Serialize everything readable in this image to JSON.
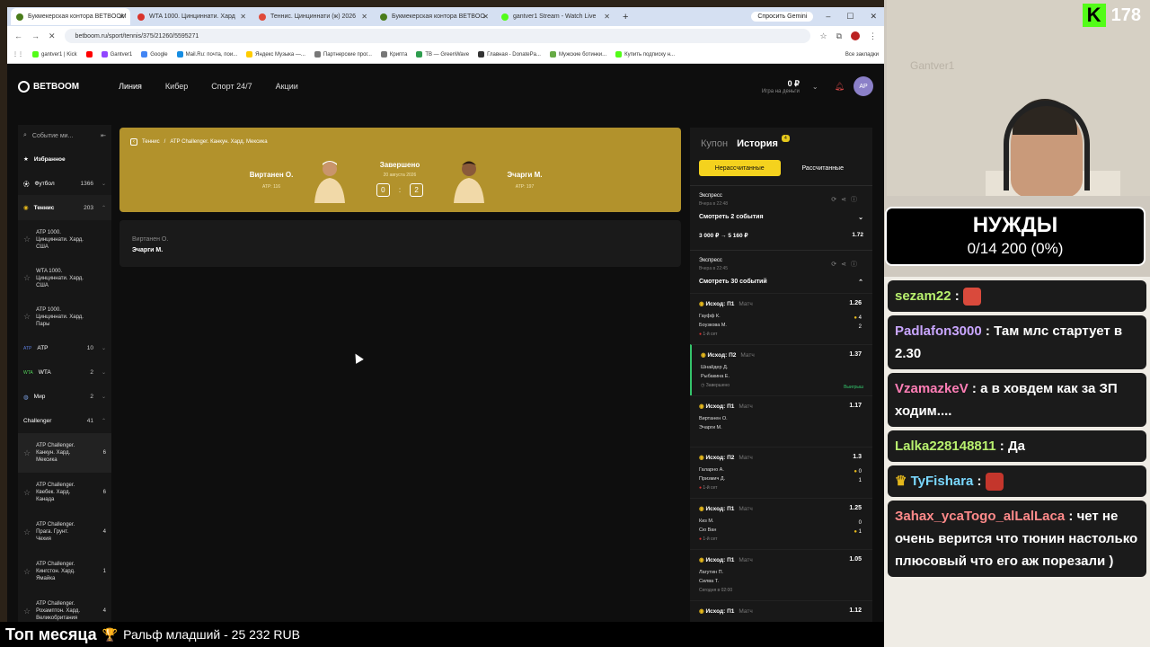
{
  "browser": {
    "tabs": [
      {
        "label": "Букмекерская контора BETBOOM",
        "color": "#4a7c1a",
        "active": true
      },
      {
        "label": "WTA 1000. Цинциннати. Хард",
        "color": "#d9332b"
      },
      {
        "label": "Теннис. Цинциннати (ж) 2026",
        "color": "#e04a3a"
      },
      {
        "label": "Букмекерская контора BETBOO",
        "color": "#4a7c1a"
      },
      {
        "label": "gantver1 Stream - Watch Live",
        "color": "#53fc18"
      }
    ],
    "gemini_label": "Спросить Gemini",
    "url": "betboom.ru/sport/tennis/375/21260/5595271",
    "bookmarks": [
      {
        "label": "gantver1 | Kick",
        "color": "#53fc18"
      },
      {
        "label": "",
        "color": "#ff0000"
      },
      {
        "label": "Gantver1",
        "color": "#9146ff"
      },
      {
        "label": "Google",
        "color": "#4285f4"
      },
      {
        "label": "Mail.Ru: почта, пои...",
        "color": "#168de2"
      },
      {
        "label": "Яндекс Музыка —...",
        "color": "#ffcc00"
      },
      {
        "label": "Партнерские прог...",
        "color": "#777777"
      },
      {
        "label": "Крипта",
        "color": "#777777"
      },
      {
        "label": "TB — GreenWave",
        "color": "#2e9d4e"
      },
      {
        "label": "Главная - DonatePa...",
        "color": "#333333"
      },
      {
        "label": "Мужские ботинки...",
        "color": "#6a4"
      },
      {
        "label": "Купить подписку н...",
        "color": "#53fc18"
      }
    ],
    "all_bookmarks": "Все закладки"
  },
  "site": {
    "logo": "BETBOOM",
    "nav": [
      "Линия",
      "Кибер",
      "Спорт 24/7",
      "Акции"
    ],
    "balance_amount": "0 ₽",
    "balance_label": "Игра на деньги",
    "avatar": "АР",
    "search_placeholder": "Событие ми...",
    "sidebar": {
      "favorites": "Избранное",
      "football": {
        "label": "Футбол",
        "count": "1366"
      },
      "tennis": {
        "label": "Теннис",
        "count": "203"
      },
      "tennis_subs": [
        {
          "label": "ATP 1000. Цинциннати. Хард. США"
        },
        {
          "label": "WTA 1000. Цинциннати. Хард. США"
        },
        {
          "label": "ATP 1000. Цинциннати. Хард. Пары"
        }
      ],
      "groups": [
        {
          "label": "ATP",
          "count": "10"
        },
        {
          "label": "WTA",
          "count": "2"
        },
        {
          "label": "Мир",
          "count": "2"
        },
        {
          "label": "Challenger",
          "count": "41"
        }
      ],
      "challenger_subs": [
        {
          "label": "ATP Challenger. Канкун. Хард. Мексика",
          "count": "6"
        },
        {
          "label": "ATP Challenger. Квебек. Хард. Канада",
          "count": "6"
        },
        {
          "label": "ATP Challenger. Прага. Грунт. Чехия",
          "count": "4"
        },
        {
          "label": "ATP Challenger. Кингстон. Хард. Ямайка",
          "count": "1"
        },
        {
          "label": "ATP Challenger. Рохамптон. Хард. Великобритания",
          "count": "4"
        }
      ]
    },
    "match": {
      "crumb_sport": "Теннис",
      "crumb_sep": "/",
      "crumb_tournament": "ATP Challenger. Канкун. Хард. Мексика",
      "player1": "Виртанен О.",
      "player1_rank": "ATP: 116",
      "player2": "Эчарги М.",
      "player2_rank": "ATP: 197",
      "status": "Завершено",
      "date": "20 августа 2026",
      "score1": "0",
      "score_sep": ":",
      "score2": "2"
    },
    "names_card": {
      "line1": "Виртанен О.",
      "line2": "Эчарги М."
    },
    "coupon": {
      "tab_coupon": "Купон",
      "tab_history": "История",
      "history_badge": "4",
      "filter_unsettled": "Нерассчитанные",
      "filter_settled": "Рассчитанные",
      "bets": [
        {
          "type": "Экспресс",
          "time": "Вчера в 22:48",
          "see": "Смотреть 2 события",
          "stake": "3 000 ₽ → 5 160 ₽",
          "odds": "1.72"
        },
        {
          "type": "Экспресс",
          "time": "Вчера в 22:45",
          "see": "Смотреть 30 событий"
        }
      ],
      "legs": [
        {
          "outcome": "Исход: П1",
          "market": "Матч",
          "odds": "1.26",
          "p1": "Гауфф К.",
          "p2": "Боузкова М.",
          "set": "1-й сет",
          "s1": "4",
          "s2": "2"
        },
        {
          "outcome": "Исход: П2",
          "market": "Матч",
          "odds": "1.37",
          "p1": "Шнайдер Д.",
          "p2": "Рыбакина Е.",
          "set": "Завершено",
          "won": "Выигрыш"
        },
        {
          "outcome": "Исход: П1",
          "market": "Матч",
          "odds": "1.17",
          "p1": "Виртанен О.",
          "p2": "Эчарги М."
        },
        {
          "outcome": "Исход: П2",
          "market": "Матч",
          "odds": "1.3",
          "p1": "Галарно А.",
          "p2": "Призмич Д.",
          "set": "1-й сет",
          "s1": "0",
          "s2": "1"
        },
        {
          "outcome": "Исход: П1",
          "market": "Матч",
          "odds": "1.25",
          "p1": "Киз М.",
          "p2": "Сю Ван",
          "set": "1-й сет",
          "s1": "0",
          "s2": "1"
        },
        {
          "outcome": "Исход: П1",
          "market": "Матч",
          "odds": "1.05",
          "p1": "Лагутин П.",
          "p2": "Силва Т.",
          "set": "Сегодня в 02:00"
        },
        {
          "outcome": "Исход: П1",
          "market": "Матч",
          "odds": "1.12"
        }
      ]
    }
  },
  "stream": {
    "watermark": "Gantver1",
    "viewers": "178",
    "needs_title": "НУЖДЫ",
    "needs_value": "0/14 200 (0%)",
    "chat": [
      {
        "user": "sezam22",
        "color": "#b8f06e",
        "text": "",
        "emote": "#d94a3c"
      },
      {
        "user": "Padlafon3000",
        "color": "#c9a6ff",
        "text": "Там млс стартует в 2.30"
      },
      {
        "user": "VzamazkeV",
        "color": "#ff7eb6",
        "text": "а в ховдем как за ЗП ходим...."
      },
      {
        "user": "Lalka228148811",
        "color": "#b8f06e",
        "text": "Да"
      },
      {
        "user": "TyFishara",
        "color": "#7ad8ff",
        "text": "",
        "emote": "#c4362c",
        "crown": "♛"
      },
      {
        "user": "Заhax_ycaTogo_alLalLaca",
        "color": "#ff8a8a",
        "text": "чет не очень верится что тюнин настолько плюсовый что его аж порезали )"
      }
    ]
  },
  "ticker": {
    "title": "Топ месяца",
    "trophy": "🏆",
    "text": "Ральф младший - 25 232 RUB"
  }
}
